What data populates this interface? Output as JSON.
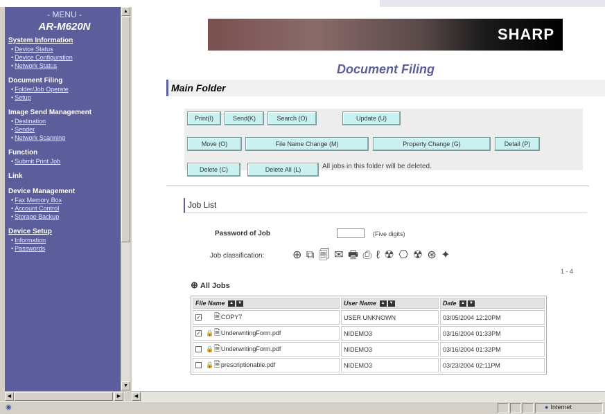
{
  "menu": {
    "header": "- MENU -",
    "model": "AR-M620N",
    "sections": [
      {
        "title": "System Information",
        "underline": true,
        "items": [
          "Device Status",
          "Device Configuration",
          "Network Status"
        ]
      },
      {
        "title": "Document Filing",
        "underline": false,
        "items": [
          "Folder/Job Operate",
          "Setup"
        ]
      },
      {
        "title": "Image Send Management",
        "underline": false,
        "items": [
          "Destination",
          "Sender",
          "Network Scanning"
        ]
      },
      {
        "title": "Function",
        "underline": false,
        "items": [
          "Submit Print Job"
        ]
      },
      {
        "title": "Link",
        "underline": false,
        "items": []
      },
      {
        "title": "Device Management",
        "underline": false,
        "items": [
          "Fax Memory Box",
          "Account Control",
          "Storage Backup"
        ]
      },
      {
        "title": "Device Setup",
        "underline": true,
        "items": [
          "Information",
          "Passwords"
        ]
      }
    ]
  },
  "banner": {
    "brand": "SHARP"
  },
  "page": {
    "title": "Document Filing",
    "folder": "Main Folder"
  },
  "buttons": {
    "print": "Print(I)",
    "send": "Send(K)",
    "search": "Search (O)",
    "update": "Update (U)",
    "move": "Move (O)",
    "file_name_change": "File Name Change (M)",
    "property_change": "Property Change (G)",
    "detail": "Detail (P)",
    "delete": "Delete (C)",
    "delete_all": "Delete All (L)",
    "delete_all_note": "All jobs in this folder will be deleted."
  },
  "job_list": {
    "title": "Job List",
    "password_label": "Password of Job",
    "password_value": "",
    "password_hint": "(Five digits)",
    "classification_label": "Job classification:",
    "classification_icons": [
      "all-jobs-icon",
      "copy-icon",
      "print-icon",
      "scan-to-email-icon",
      "fax-icon",
      "internet-fax-icon",
      "scan-icon",
      "pc-fax-icon",
      "pc-scan-icon",
      "fax-receive-icon",
      "folder-icon",
      "other-icon"
    ],
    "classification_glyphs": "⊕ ⧉ 🗐 ✉ 🖶 ⎙ ℓ ☢ ⎔ ☢ ⊛ ✦",
    "page_count": "1 - 4",
    "all_jobs_label": "All Jobs",
    "columns": [
      "File Name",
      "User Name",
      "Date"
    ],
    "rows": [
      {
        "checked": true,
        "locked": false,
        "file": "COPY7",
        "user": "USER UNKNOWN",
        "date": "03/05/2004 12:20PM"
      },
      {
        "checked": true,
        "locked": true,
        "file": "UnderwritingForm.pdf",
        "user": "NIDEMO3",
        "date": "03/16/2004 01:33PM"
      },
      {
        "checked": false,
        "locked": true,
        "file": "UnderwritingForm.pdf",
        "user": "NIDEMO3",
        "date": "03/16/2004 01:32PM"
      },
      {
        "checked": false,
        "locked": true,
        "file": "prescriptionable.pdf",
        "user": "NIDEMO3",
        "date": "03/23/2004 02:11PM"
      }
    ]
  },
  "status": {
    "zone": "Internet"
  },
  "colors": {
    "menu_bg": "#5c5d9b",
    "button_bg": "#c9f1f1",
    "title": "#5c5d9b"
  }
}
